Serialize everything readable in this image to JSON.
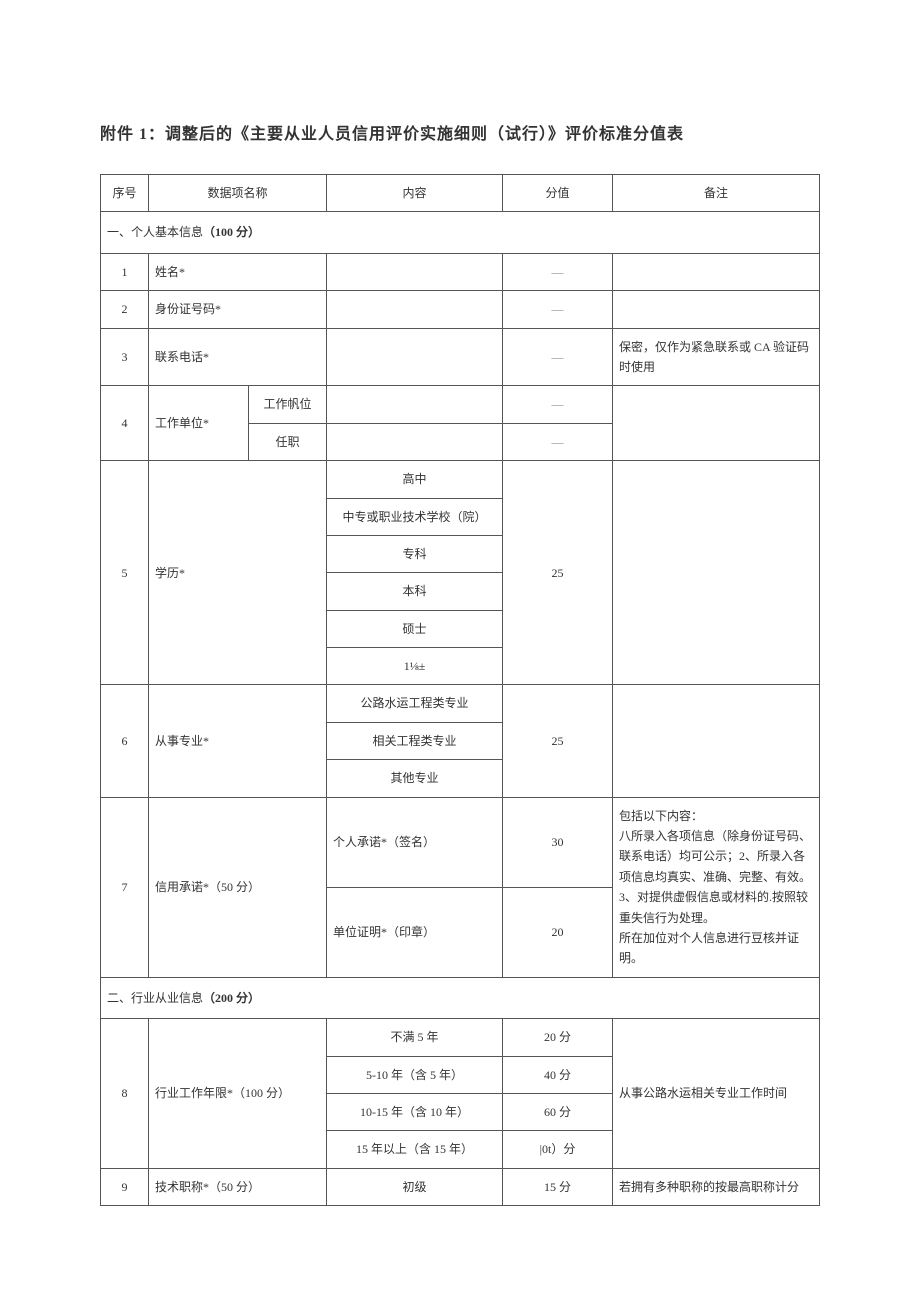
{
  "title": "附件 1：调整后的《主要从业人员信用评价实施细则（试行）》评价标准分值表",
  "headers": {
    "seq": "序号",
    "name": "数据项名称",
    "content": "内容",
    "score": "分值",
    "remark": "备注"
  },
  "section1": {
    "label_prefix": "一、个人基本信息",
    "label_points": "（100 分）"
  },
  "r1": {
    "seq": "1",
    "name": "姓名*",
    "score": "—"
  },
  "r2": {
    "seq": "2",
    "name": "身份证号码*",
    "score": "—"
  },
  "r3": {
    "seq": "3",
    "name": "联系电话*",
    "score": "—",
    "remark": "保密，仅作为紧急联系或 CA 验证码时使用"
  },
  "r4": {
    "seq": "4",
    "name": "工作单位*",
    "sub1": "工作帆位",
    "sub2": "任职",
    "score1": "—",
    "score2": "—"
  },
  "r5": {
    "seq": "5",
    "name": "学历*",
    "opts": [
      "高中",
      "中专或职业技术学校（院）",
      "专科",
      "本科",
      "硕士",
      "1⅛±"
    ],
    "score": "25"
  },
  "r6": {
    "seq": "6",
    "name": "从事专业*",
    "opts": [
      "公路水运工程类专业",
      "相关工程类专业",
      "其他专业"
    ],
    "score": "25"
  },
  "r7": {
    "seq": "7",
    "name": "信用承诺*（50 分）",
    "sub1": "个人承诺*（签名）",
    "score1": "30",
    "sub2": "单位证明*（印章）",
    "score2": "20",
    "remark": "包括以下内容：\n八所录入各项信息（除身份证号码、联系电话）均可公示；2、所录入各项信息均真实、准确、完整、有效。\n3、对提供虚假信息或材料的.按照较重失信行为处理。\n所在加位对个人信息进行豆核并证明。"
  },
  "section2": {
    "label_prefix": "二、行业从业信息",
    "label_points": "（200 分）"
  },
  "r8": {
    "seq": "8",
    "name": "行业工作年限*（100 分）",
    "opts": [
      "不满 5 年",
      "5-10 年（含 5 年）",
      "10-15 年（含 10 年）",
      "15 年以上（含 15 年）"
    ],
    "scores": [
      "20 分",
      "40 分",
      "60 分",
      "|0t）分"
    ],
    "remark": "从事公路水运相关专业工作时间"
  },
  "r9": {
    "seq": "9",
    "name": "技术职称*（50 分）",
    "opt": "初级",
    "score": "15 分",
    "remark": "若拥有多种职称的按最高职称计分"
  }
}
